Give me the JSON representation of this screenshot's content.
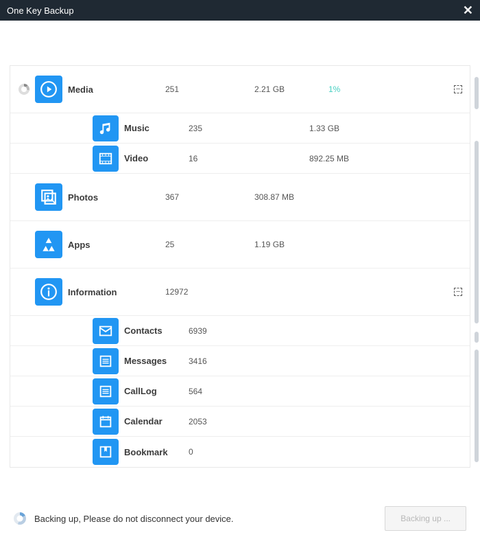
{
  "window": {
    "title": "One Key Backup",
    "close_glyph": "✕"
  },
  "categories": [
    {
      "key": "media",
      "icon": "play-icon",
      "label": "Media",
      "count": "251",
      "size": "2.21 GB",
      "percent": "1%",
      "spinning": true,
      "expandable": true,
      "children": [
        {
          "key": "music",
          "icon": "music-icon",
          "label": "Music",
          "count": "235",
          "size": "1.33 GB"
        },
        {
          "key": "video",
          "icon": "video-icon",
          "label": "Video",
          "count": "16",
          "size": "892.25 MB"
        }
      ]
    },
    {
      "key": "photos",
      "icon": "photos-icon",
      "label": "Photos",
      "count": "367",
      "size": "308.87 MB",
      "percent": "",
      "spinning": false,
      "expandable": false,
      "children": []
    },
    {
      "key": "apps",
      "icon": "apps-icon",
      "label": "Apps",
      "count": "25",
      "size": "1.19 GB",
      "percent": "",
      "spinning": false,
      "expandable": false,
      "children": []
    },
    {
      "key": "information",
      "icon": "info-icon",
      "label": "Information",
      "count": "12972",
      "size": "",
      "percent": "",
      "spinning": false,
      "expandable": true,
      "children": [
        {
          "key": "contacts",
          "icon": "contacts-icon",
          "label": "Contacts",
          "count": "6939",
          "size": ""
        },
        {
          "key": "messages",
          "icon": "messages-icon",
          "label": "Messages",
          "count": "3416",
          "size": ""
        },
        {
          "key": "calllog",
          "icon": "calllog-icon",
          "label": "CallLog",
          "count": "564",
          "size": ""
        },
        {
          "key": "calendar",
          "icon": "calendar-icon",
          "label": "Calendar",
          "count": "2053",
          "size": ""
        },
        {
          "key": "bookmark",
          "icon": "bookmark-icon",
          "label": "Bookmark",
          "count": "0",
          "size": ""
        }
      ]
    }
  ],
  "footer": {
    "status_text": "Backing up, Please do not disconnect your device.",
    "button_label": "Backing up ..."
  },
  "collapse_glyph": "‒"
}
